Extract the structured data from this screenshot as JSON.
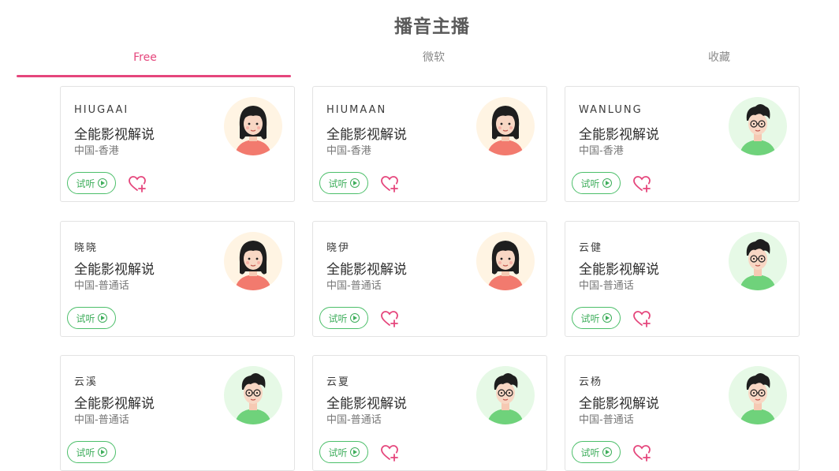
{
  "page_title": "播音主播",
  "tabs": [
    {
      "label": "Free",
      "active": true
    },
    {
      "label": "微软",
      "active": false
    },
    {
      "label": "收藏",
      "active": false
    }
  ],
  "trial_label": "试听",
  "colors": {
    "accent": "#e5467c",
    "trial_green": "#3fae5c"
  },
  "cards": [
    {
      "name": "HIUGAAI",
      "style": "全能影视解说",
      "region": "中国-香港",
      "avatar": "female",
      "favorite": true
    },
    {
      "name": "HIUMAAN",
      "style": "全能影视解说",
      "region": "中国-香港",
      "avatar": "female",
      "favorite": true
    },
    {
      "name": "WANLUNG",
      "style": "全能影视解说",
      "region": "中国-香港",
      "avatar": "male",
      "favorite": true
    },
    {
      "name": "晓晓",
      "style": "全能影视解说",
      "region": "中国-普通话",
      "avatar": "female",
      "favorite": false
    },
    {
      "name": "晓伊",
      "style": "全能影视解说",
      "region": "中国-普通话",
      "avatar": "female",
      "favorite": true
    },
    {
      "name": "云健",
      "style": "全能影视解说",
      "region": "中国-普通话",
      "avatar": "male",
      "favorite": true
    },
    {
      "name": "云溪",
      "style": "全能影视解说",
      "region": "中国-普通话",
      "avatar": "male",
      "favorite": false
    },
    {
      "name": "云夏",
      "style": "全能影视解说",
      "region": "中国-普通话",
      "avatar": "male",
      "favorite": true
    },
    {
      "name": "云杨",
      "style": "全能影视解说",
      "region": "中国-普通话",
      "avatar": "male",
      "favorite": true
    }
  ]
}
